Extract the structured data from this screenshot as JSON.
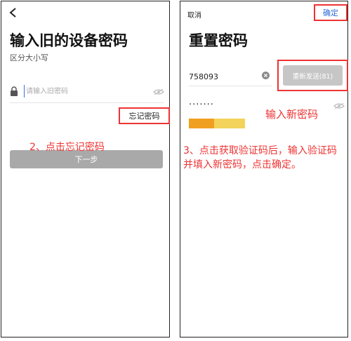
{
  "left": {
    "title": "输入旧的设备密码",
    "subtitle": "区分大小写",
    "old_password": {
      "placeholder": "请输入旧密码",
      "value": ""
    },
    "forgot_label": "忘记密码",
    "next_label": "下一步",
    "step_annotation": "2、点击忘记密码",
    "icons": [
      "back-arrow",
      "lock",
      "eye-hidden"
    ]
  },
  "right": {
    "cancel_label": "取消",
    "confirm_label": "确定",
    "title": "重置密码",
    "code": {
      "value": "758093"
    },
    "resend_label": "重新发送(81)",
    "new_password": {
      "value": "·······"
    },
    "new_password_annotation": "输入新密码",
    "step_annotation": "3、点击获取验证码后，输入验证码并填入新密码，点击确定。",
    "password_strength": 0.35,
    "icons": [
      "clear",
      "eye-hidden"
    ]
  },
  "colors": {
    "annotation_red": "#e33333",
    "link_blue": "#2f6bd8",
    "disabled_button": "#a9a9a9",
    "strength_orange": "#f0a020",
    "strength_yellow": "#f3d35a"
  }
}
